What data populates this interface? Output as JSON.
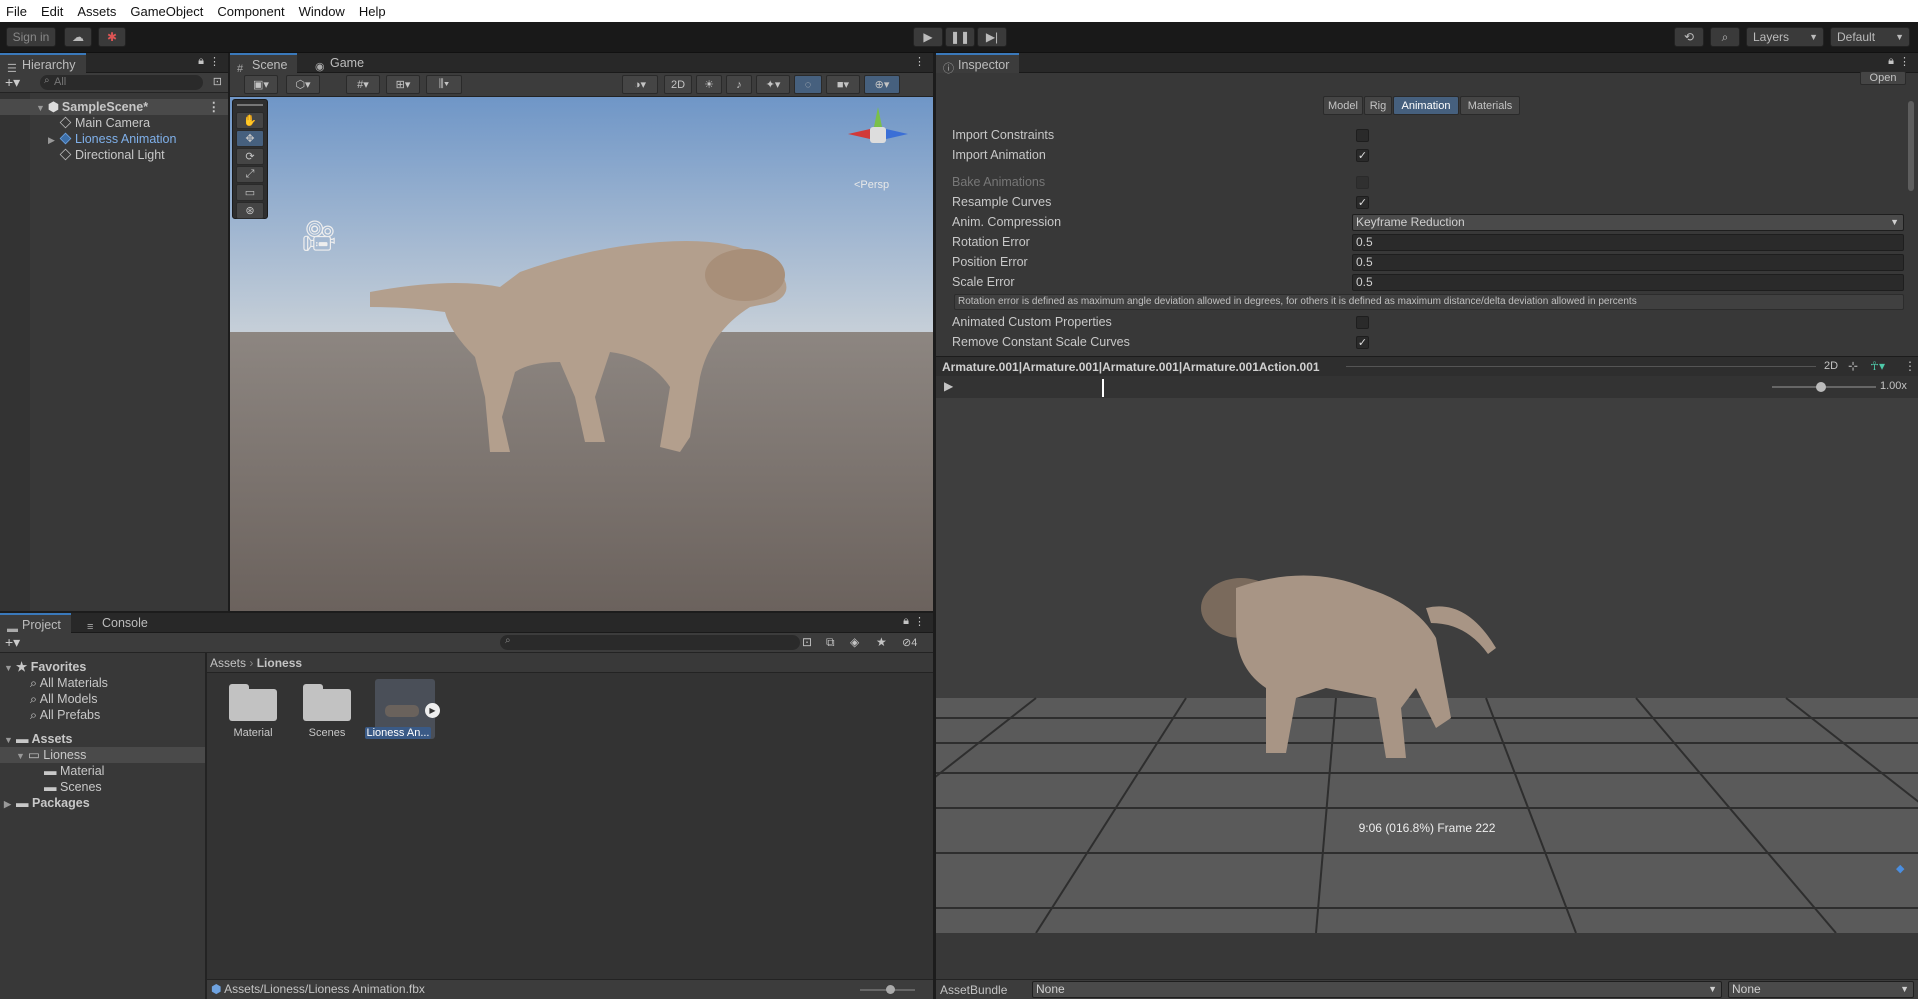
{
  "menu": [
    "File",
    "Edit",
    "Assets",
    "GameObject",
    "Component",
    "Window",
    "Help"
  ],
  "toolbar": {
    "sign_in": "Sign in",
    "layers": "Layers",
    "layout": "Default"
  },
  "hierarchy": {
    "tab": "Hierarchy",
    "search_placeholder": "All",
    "scene": "SampleScene*",
    "items": [
      "Main Camera",
      "Lioness Animation",
      "Directional Light"
    ]
  },
  "scene": {
    "tabs": [
      "Scene",
      "Game"
    ],
    "btn_2d": "2D",
    "persp": "<Persp"
  },
  "project": {
    "tabs": [
      "Project",
      "Console"
    ],
    "hidden_count": "4",
    "favorites": {
      "label": "Favorites",
      "items": [
        "All Materials",
        "All Models",
        "All Prefabs"
      ]
    },
    "assets": {
      "label": "Assets",
      "lioness": "Lioness",
      "children": [
        "Material",
        "Scenes"
      ]
    },
    "packages": "Packages",
    "breadcrumb": [
      "Assets",
      "Lioness"
    ],
    "grid": [
      "Material",
      "Scenes",
      "Lioness An..."
    ],
    "footer_path": "Assets/Lioness/Lioness Animation.fbx"
  },
  "inspector": {
    "tab": "Inspector",
    "open_btn": "Open",
    "tabs": [
      "Model",
      "Rig",
      "Animation",
      "Materials"
    ],
    "active_tab": "Animation",
    "rows": {
      "import_constraints": "Import Constraints",
      "import_animation": "Import Animation",
      "bake_animations": "Bake Animations",
      "resample_curves": "Resample Curves",
      "anim_compression": "Anim. Compression",
      "anim_compression_value": "Keyframe Reduction",
      "rotation_error": "Rotation Error",
      "rotation_error_value": "0.5",
      "position_error": "Position Error",
      "position_error_value": "0.5",
      "scale_error": "Scale Error",
      "scale_error_value": "0.5",
      "help": "Rotation error is defined as maximum angle deviation allowed in degrees, for others it is defined as maximum distance/delta deviation allowed in percents",
      "animated_custom": "Animated Custom Properties",
      "remove_constant": "Remove Constant Scale Curves"
    },
    "checks": {
      "import_constraints": false,
      "import_animation": true,
      "bake_animations": false,
      "resample_curves": true,
      "animated_custom": false,
      "remove_constant": true
    },
    "preview": {
      "clip": "Armature.001|Armature.001|Armature.001|Armature.001Action.001",
      "btn_2d": "2D",
      "speed": "1.00x",
      "status": "9:06 (016.8%) Frame 222"
    },
    "asset_bundle": {
      "label": "AssetBundle",
      "name": "None",
      "variant": "None"
    }
  }
}
